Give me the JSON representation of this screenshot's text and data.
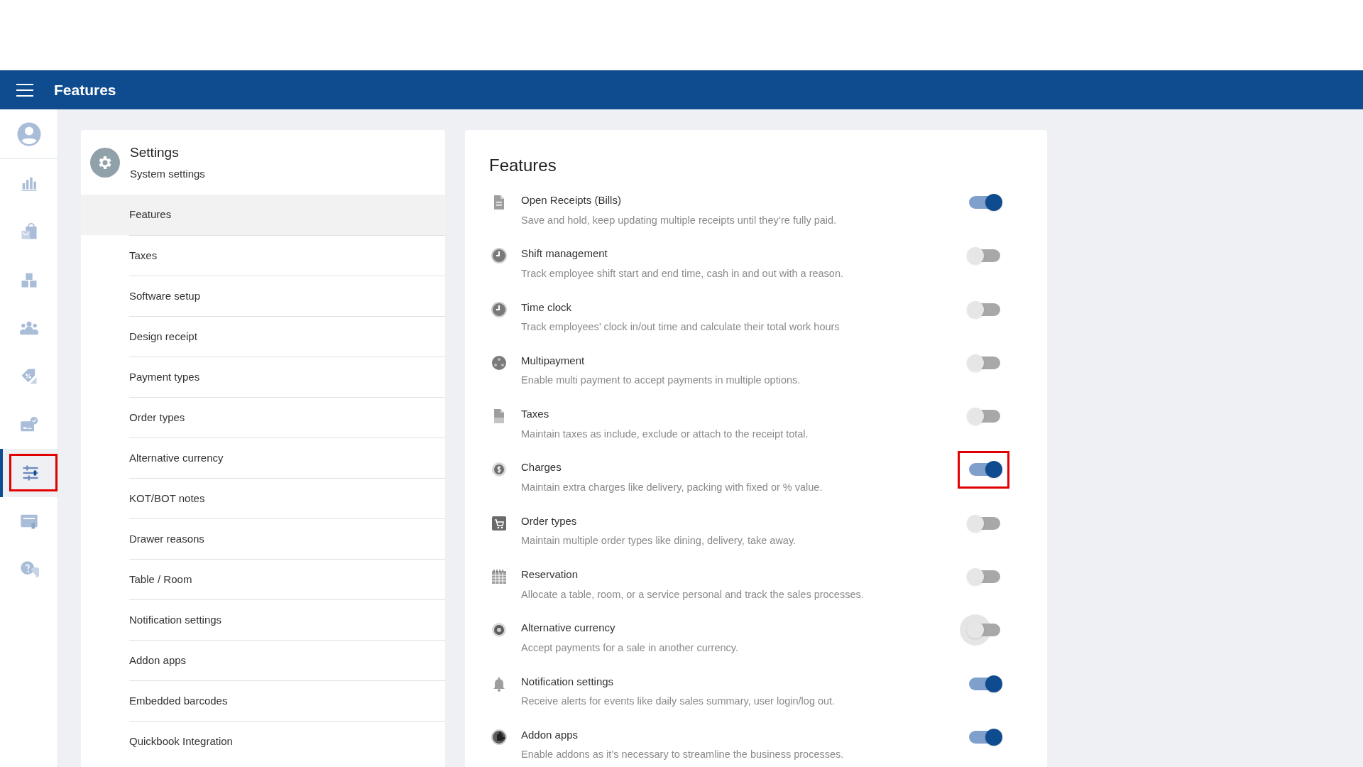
{
  "header": {
    "title": "Features"
  },
  "sidebar": {
    "items": [
      {
        "kind": "avatar",
        "selected": false,
        "highlighted": false
      },
      {
        "kind": "chart",
        "selected": false,
        "highlighted": false
      },
      {
        "kind": "bag",
        "selected": false,
        "highlighted": false
      },
      {
        "kind": "boxes",
        "selected": false,
        "highlighted": false
      },
      {
        "kind": "people",
        "selected": false,
        "highlighted": false
      },
      {
        "kind": "tag",
        "selected": false,
        "highlighted": false
      },
      {
        "kind": "card",
        "selected": false,
        "highlighted": false
      },
      {
        "kind": "sliders",
        "selected": true,
        "highlighted": true
      },
      {
        "kind": "window",
        "selected": false,
        "highlighted": false
      },
      {
        "kind": "help",
        "selected": false,
        "highlighted": false
      }
    ]
  },
  "settings": {
    "title": "Settings",
    "subtitle": "System settings",
    "items": [
      {
        "label": "Features",
        "selected": true
      },
      {
        "label": "Taxes",
        "selected": false
      },
      {
        "label": "Software setup",
        "selected": false
      },
      {
        "label": "Design receipt",
        "selected": false
      },
      {
        "label": "Payment types",
        "selected": false
      },
      {
        "label": "Order types",
        "selected": false
      },
      {
        "label": "Alternative currency",
        "selected": false
      },
      {
        "label": "KOT/BOT notes",
        "selected": false
      },
      {
        "label": "Drawer reasons",
        "selected": false
      },
      {
        "label": "Table / Room",
        "selected": false
      },
      {
        "label": "Notification settings",
        "selected": false
      },
      {
        "label": "Addon apps",
        "selected": false
      },
      {
        "label": "Embedded barcodes",
        "selected": false
      },
      {
        "label": "Quickbook Integration",
        "selected": false
      }
    ]
  },
  "features": {
    "title": "Features",
    "items": [
      {
        "kind": "document",
        "title": "Open Receipts (Bills)",
        "description": "Save and hold, keep updating multiple receipts until they’re fully paid.",
        "on": true,
        "highlighted": false,
        "focused": false
      },
      {
        "kind": "clock",
        "title": "Shift management",
        "description": "Track employee shift start and end time, cash in and out with a reason.",
        "on": false,
        "highlighted": false,
        "focused": false
      },
      {
        "kind": "clock",
        "title": "Time clock",
        "description": "Track employees’ clock in/out time and calculate their total work hours",
        "on": false,
        "highlighted": false,
        "focused": false
      },
      {
        "kind": "payment",
        "title": "Multipayment",
        "description": "Enable multi payment to accept payments in multiple options.",
        "on": false,
        "highlighted": false,
        "focused": false
      },
      {
        "kind": "taxfile",
        "title": "Taxes",
        "description": "Maintain taxes as include, exclude or attach to the receipt total.",
        "on": false,
        "highlighted": false,
        "focused": false
      },
      {
        "kind": "coin",
        "title": "Charges",
        "description": "Maintain extra charges like delivery, packing with fixed or % value.",
        "on": true,
        "highlighted": true,
        "focused": false
      },
      {
        "kind": "cart",
        "title": "Order types",
        "description": "Maintain multiple order types like dining, delivery, take away.",
        "on": false,
        "highlighted": false,
        "focused": false
      },
      {
        "kind": "calendar",
        "title": "Reservation",
        "description": "Allocate a table, room, or a service personal and track the sales processes.",
        "on": false,
        "highlighted": false,
        "focused": false
      },
      {
        "kind": "currency",
        "title": "Alternative currency",
        "description": "Accept payments for a sale in another currency.",
        "on": false,
        "highlighted": false,
        "focused": true
      },
      {
        "kind": "bell",
        "title": "Notification settings",
        "description": "Receive alerts for events like daily sales summary, user login/log out.",
        "on": true,
        "highlighted": false,
        "focused": false
      },
      {
        "kind": "puzzle",
        "title": "Addon apps",
        "description": "Enable addons as it’s necessary to streamline the business processes.",
        "on": true,
        "highlighted": false,
        "focused": false
      }
    ]
  }
}
